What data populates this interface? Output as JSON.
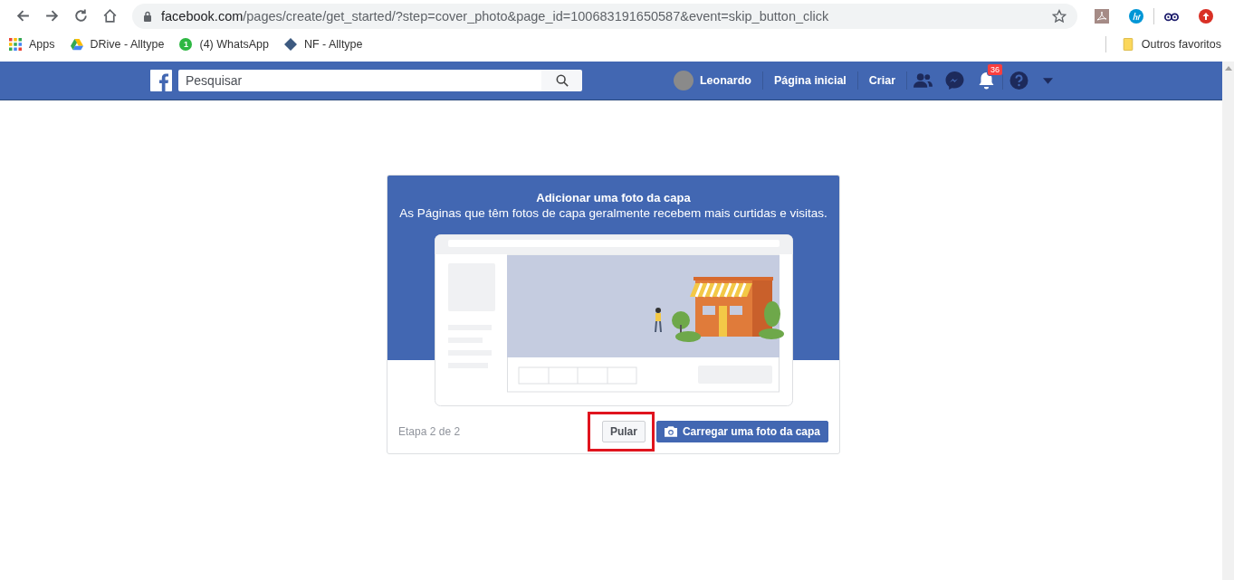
{
  "browser": {
    "url_host": "facebook.com",
    "url_path": "/pages/create/get_started/?step=cover_photo&page_id=100683191650587&event=skip_button_click"
  },
  "bookmarks": [
    {
      "label": "Apps",
      "kind": "apps"
    },
    {
      "label": "DRive - Alltype",
      "kind": "drive"
    },
    {
      "label": "(4) WhatsApp",
      "kind": "whatsapp",
      "badge": "1"
    },
    {
      "label": "NF - Alltype",
      "kind": "nf"
    }
  ],
  "other_bookmarks": "Outros favoritos",
  "topbar": {
    "search": {
      "placeholder": "Pesquisar"
    },
    "user": "Leonardo",
    "links": [
      "Página inicial",
      "Criar"
    ],
    "notifications": "36"
  },
  "dialog": {
    "title": "Adicionar uma foto da capa",
    "subtitle": "As Páginas que têm fotos de capa geralmente recebem mais curtidas e visitas.",
    "step": "Etapa 2 de 2",
    "skip_button": {
      "label": "Pular",
      "highlighted": true
    },
    "upload_button": "Carregar uma foto da capa"
  }
}
